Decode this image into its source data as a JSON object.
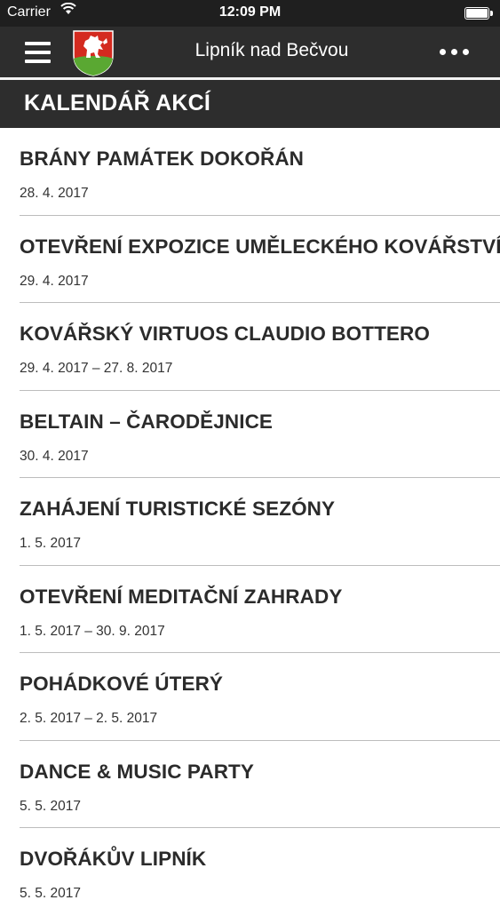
{
  "status": {
    "carrier": "Carrier",
    "time": "12:09 PM"
  },
  "nav": {
    "title": "Lipník nad Bečvou",
    "menu_icon": "hamburger-icon",
    "more_icon": "ellipsis-icon",
    "logo": "coat-of-arms-lion-shield"
  },
  "section": {
    "title": "KALENDÁŘ AKCÍ"
  },
  "events": [
    {
      "title": "BRÁNY PAMÁTEK DOKOŘÁN",
      "date": "28. 4. 2017"
    },
    {
      "title": "OTEVŘENÍ EXPOZICE UMĚLECKÉHO KOVÁŘSTVÍ",
      "date": "29. 4. 2017"
    },
    {
      "title": "KOVÁŘSKÝ VIRTUOS CLAUDIO BOTTERO",
      "date": "29. 4. 2017 – 27. 8. 2017"
    },
    {
      "title": "BELTAIN – ČARODĚJNICE",
      "date": "30. 4. 2017"
    },
    {
      "title": "ZAHÁJENÍ TURISTICKÉ SEZÓNY",
      "date": "1. 5. 2017"
    },
    {
      "title": "OTEVŘENÍ MEDITAČNÍ ZAHRADY",
      "date": "1. 5. 2017 – 30. 9. 2017"
    },
    {
      "title": "POHÁDKOVÉ ÚTERÝ",
      "date": "2. 5. 2017 – 2. 5. 2017"
    },
    {
      "title": "DANCE & MUSIC PARTY",
      "date": "5. 5. 2017"
    },
    {
      "title": "DVOŘÁKŮV LIPNÍK",
      "date": "5. 5. 2017"
    }
  ],
  "colors": {
    "bar": "#2d2d2d",
    "shield_red": "#d42a1f",
    "shield_green": "#5aa832"
  }
}
